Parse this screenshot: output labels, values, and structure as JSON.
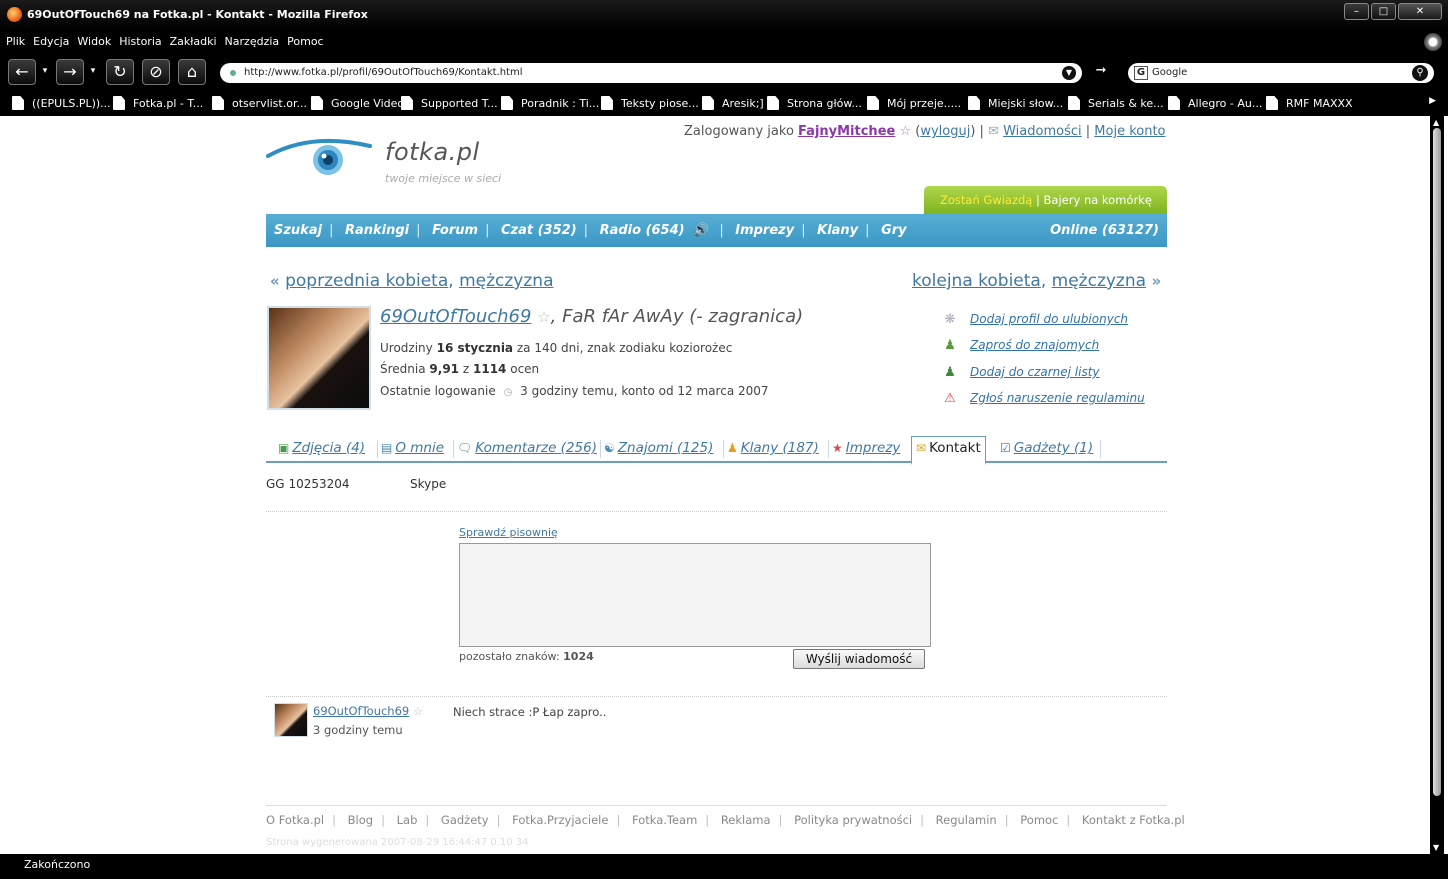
{
  "browser": {
    "window_title": "69OutOfTouch69 na Fotka.pl - Kontakt - Mozilla Firefox",
    "menu": [
      "Plik",
      "Edycja",
      "Widok",
      "Historia",
      "Zakładki",
      "Narzędzia",
      "Pomoc"
    ],
    "url": "http://www.fotka.pl/profil/69OutOfTouch69/Kontakt.html",
    "search_engine": "Google",
    "search_placeholder": "Google",
    "bookmarks": [
      "((EPULS.PL))...",
      "Fotka.pl - T...",
      "otservlist.or...",
      "Google Video",
      "Supported T...",
      "Poradnik : Ti...",
      "Teksty piose...",
      "Aresik;]",
      "Strona głów...",
      "Mój przeje.....",
      "Miejski słow...",
      "Serials & ke...",
      "Allegro - Au...",
      "RMF MAXXX"
    ],
    "status": "Zakończono"
  },
  "site": {
    "logo_text": "fotka.pl",
    "tagline": "twoje miejsce w sieci",
    "userbar": {
      "logged_as": "Zalogowany jako",
      "nick": "FajnyMitchee",
      "logout": "wyloguj",
      "messages": "Wiadomości",
      "account": "Moje konto"
    },
    "promo": {
      "star": "Zostań Gwiazdą",
      "ringtones": "Bajery na komórkę"
    },
    "nav": {
      "search": "Szukaj",
      "rankings": "Rankingi",
      "forum": "Forum",
      "chat": "Czat (352)",
      "radio": "Radio (654)",
      "events": "Imprezy",
      "clans": "Klany",
      "games": "Gry",
      "online": "Online (63127)"
    },
    "prev": {
      "woman": "poprzednia kobieta",
      "man": "mężczyzna"
    },
    "next": {
      "woman": "kolejna kobieta",
      "man": "mężczyzna"
    },
    "profile": {
      "nick": "69OutOfTouch69",
      "tagline": ", FaR fAr AwAy (- zagranica)",
      "birthday_label": "Urodziny",
      "birthday_date": "16 stycznia",
      "birthday_rest": "za 140 dni, znak zodiaku koziorożec",
      "rating_label": "Średnia",
      "rating_value": "9,91",
      "rating_sep": "z",
      "rating_count": "1114",
      "rating_rest": "ocen",
      "last_login_label": "Ostatnie logowanie",
      "last_login_value": "3 godziny temu, konto od 12 marca 2007"
    },
    "actions": [
      "Dodaj profil do ulubionych",
      "Zaproś do znajomych",
      "Dodaj do czarnej listy",
      "Zgłoś naruszenie regulaminu"
    ],
    "tabs": {
      "photos": "Zdjęcia (4)",
      "about": "O mnie",
      "comments": "Komentarze (256)",
      "friends": "Znajomi (125)",
      "clans": "Klany (187)",
      "events": "Imprezy",
      "contact": "Kontakt",
      "gadgets": "Gadżety (1)"
    },
    "contact": {
      "gg_label": "GG",
      "gg_number": "10253204",
      "skype": "Skype"
    },
    "form": {
      "spellcheck": "Sprawdź pisownię",
      "remaining_label": "pozostało znaków:",
      "remaining_value": "1024",
      "send": "Wyślij wiadomość"
    },
    "last_message": {
      "nick": "69OutOfTouch69",
      "time": "3 godziny temu",
      "text": "Niech strace :P Łap zapro.."
    },
    "footer": [
      "O Fotka.pl",
      "Blog",
      "Lab",
      "Gadżety",
      "Fotka.Przyjaciele",
      "Fotka.Team",
      "Reklama",
      "Polityka prywatności",
      "Regulamin",
      "Pomoc",
      "Kontakt z Fotka.pl"
    ],
    "generated": "Strona wygenerowana 2007-08-29 16:44:47 0.10 34"
  },
  "colors": {
    "nav_blue": "#3a97c4",
    "link_blue": "#3f78a0",
    "promo_green": "#7fb321",
    "nick_purple": "#8a3aa8"
  }
}
